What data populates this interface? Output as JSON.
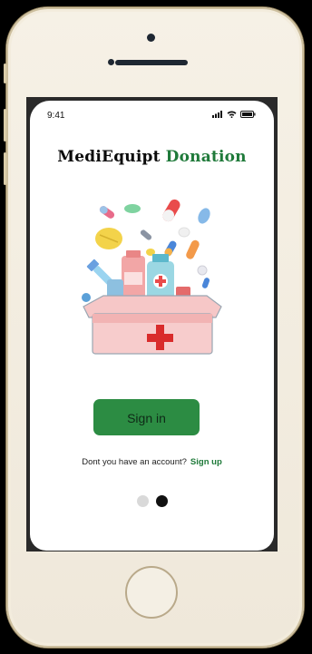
{
  "status_bar": {
    "time": "9:41"
  },
  "title": {
    "part1": "MediEquipt",
    "part2": "Donation"
  },
  "illustration": {
    "icon": "medical-kit-illustration"
  },
  "sign_in": {
    "label": "Sign in"
  },
  "signup": {
    "prompt": "Dont you have an account?",
    "link": "Sign up"
  },
  "pager": {
    "count": 2,
    "active_index": 1
  },
  "colors": {
    "brand_green": "#2c8c43",
    "title_green": "#1f7a3a",
    "dot_inactive": "#d9d9d9",
    "dot_active": "#111111"
  }
}
